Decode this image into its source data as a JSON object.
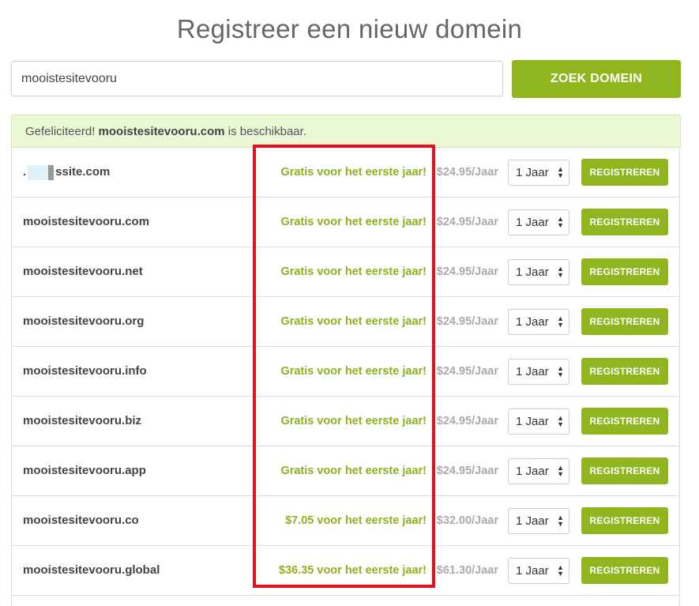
{
  "page": {
    "title": "Registreer een nieuw domein"
  },
  "search": {
    "value": "mooistesitevooru",
    "button_label": "ZOEK DOMEIN"
  },
  "banner": {
    "prefix": "Gefeliciteerd!",
    "domain": "mooistesitevooru.com",
    "suffix": "is beschikbaar."
  },
  "colors": {
    "accent": "#8fb51f",
    "promo": "#8db11c",
    "highlight": "#e8101a",
    "banner_bg": "#eaf8d6"
  },
  "icons": {
    "select_arrows": "up-down-chevron-icon"
  },
  "domains": [
    {
      "name": "ssite.com",
      "promo": "Gratis voor het eerste jaar!",
      "price": "$24.95/Jaar",
      "period": "1 Jaar",
      "button": "REGISTREREN"
    },
    {
      "name": "mooistesitevooru.com",
      "promo": "Gratis voor het eerste jaar!",
      "price": "$24.95/Jaar",
      "period": "1 Jaar",
      "button": "REGISTREREN"
    },
    {
      "name": "mooistesitevooru.net",
      "promo": "Gratis voor het eerste jaar!",
      "price": "$24.95/Jaar",
      "period": "1 Jaar",
      "button": "REGISTREREN"
    },
    {
      "name": "mooistesitevooru.org",
      "promo": "Gratis voor het eerste jaar!",
      "price": "$24.95/Jaar",
      "period": "1 Jaar",
      "button": "REGISTREREN"
    },
    {
      "name": "mooistesitevooru.info",
      "promo": "Gratis voor het eerste jaar!",
      "price": "$24.95/Jaar",
      "period": "1 Jaar",
      "button": "REGISTREREN"
    },
    {
      "name": "mooistesitevooru.biz",
      "promo": "Gratis voor het eerste jaar!",
      "price": "$24.95/Jaar",
      "period": "1 Jaar",
      "button": "REGISTREREN"
    },
    {
      "name": "mooistesitevooru.app",
      "promo": "Gratis voor het eerste jaar!",
      "price": "$24.95/Jaar",
      "period": "1 Jaar",
      "button": "REGISTREREN"
    },
    {
      "name": "mooistesitevooru.co",
      "promo": "$7.05 voor het eerste jaar!",
      "price": "$32.00/Jaar",
      "period": "1 Jaar",
      "button": "REGISTREREN"
    },
    {
      "name": "mooistesitevooru.global",
      "promo": "$36.35 voor het eerste jaar!",
      "price": "$61.30/Jaar",
      "period": "1 Jaar",
      "button": "REGISTREREN"
    }
  ]
}
